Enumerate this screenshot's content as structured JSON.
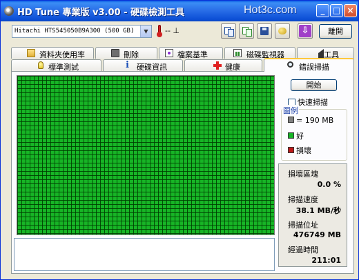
{
  "window": {
    "title": "HD Tune 專業版 v3.00 - 硬碟檢測工具",
    "watermark": "Hot3c.com",
    "controls": [
      "_",
      "□",
      "×"
    ]
  },
  "toolbar": {
    "drive_value": "Hitachi HTS545050B9A300 (500 GB)",
    "temperature": "-- ⊥",
    "exit_label": "離開",
    "icons": [
      "copy-text-icon",
      "copy-screen-icon",
      "save-icon",
      "options-icon",
      "download-icon"
    ]
  },
  "tabs_top": [
    {
      "label": "資料夾使用率",
      "icon": "folder-icon"
    },
    {
      "label": "刪除",
      "icon": "trash-icon"
    },
    {
      "label": "檔案基準",
      "icon": "file-benchmark-icon"
    },
    {
      "label": "磁碟監視器",
      "icon": "monitor-icon"
    },
    {
      "label": "工具",
      "icon": "speaker-icon"
    }
  ],
  "tabs_bottom": [
    {
      "label": "標準測試",
      "icon": "bulb-icon"
    },
    {
      "label": "硬碟資訊",
      "icon": "info-icon"
    },
    {
      "label": "健康",
      "icon": "health-cross-icon"
    },
    {
      "label": "錯誤掃描",
      "icon": "magnifier-icon",
      "active": true
    }
  ],
  "scan": {
    "start_label": "開始",
    "quick_scan_label": "快速掃描",
    "quick_scan_checked": false,
    "legend_title": "圖例",
    "legend": {
      "block_size": "= 190 MB",
      "good": "好",
      "damaged": "損壞"
    },
    "colors": {
      "block": "#808080",
      "good": "#17b526",
      "damaged": "#c01818"
    }
  },
  "stats": {
    "damaged_blocks_label": "損壞區塊",
    "damaged_blocks_value": "0.0 %",
    "scan_speed_label": "掃描速度",
    "scan_speed_value": "38.1 MB/秒",
    "scan_position_label": "掃描位址",
    "scan_position_value": "476749 MB",
    "elapsed_label": "經過時間",
    "elapsed_value": "211:01"
  }
}
